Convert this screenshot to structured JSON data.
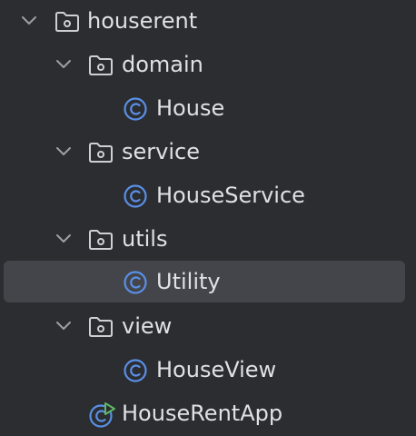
{
  "tree": {
    "nodes": [
      {
        "label": "houserent",
        "kind": "folder",
        "expanded": true,
        "icon": "package-folder-icon"
      },
      {
        "label": "domain",
        "kind": "folder",
        "expanded": true,
        "icon": "package-folder-icon"
      },
      {
        "label": "House",
        "kind": "class",
        "icon": "class-icon"
      },
      {
        "label": "service",
        "kind": "folder",
        "expanded": true,
        "icon": "package-folder-icon"
      },
      {
        "label": "HouseService",
        "kind": "class",
        "icon": "class-icon"
      },
      {
        "label": "utils",
        "kind": "folder",
        "expanded": true,
        "icon": "package-folder-icon"
      },
      {
        "label": "Utility",
        "kind": "class",
        "icon": "class-icon",
        "selected": true
      },
      {
        "label": "view",
        "kind": "folder",
        "expanded": true,
        "icon": "package-folder-icon"
      },
      {
        "label": "HouseView",
        "kind": "class",
        "icon": "class-icon"
      },
      {
        "label": "HouseRentApp",
        "kind": "runnable-class",
        "icon": "runnable-class-icon"
      }
    ]
  },
  "colors": {
    "background": "#2b2d30",
    "text": "#dfe1e5",
    "selection": "#43454a",
    "class_icon": "#5a8fe6",
    "run_badge": "#5fb865",
    "folder_icon": "#ced0d6"
  }
}
